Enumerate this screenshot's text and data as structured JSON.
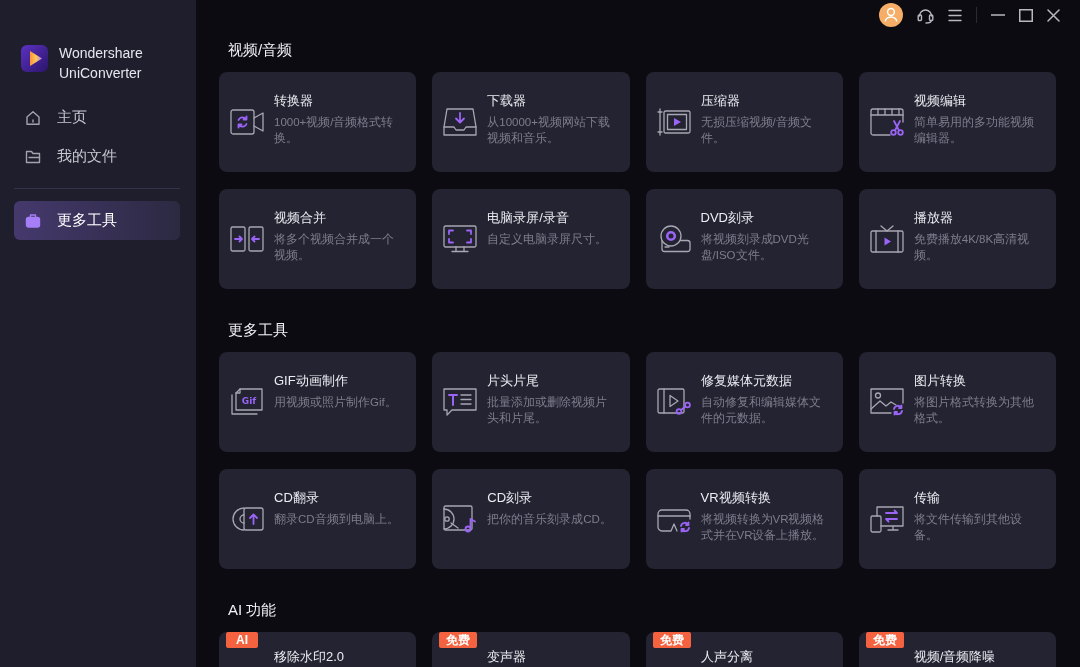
{
  "app": {
    "name": "Wondershare UniConverter"
  },
  "sidebar": {
    "groups": [
      {
        "items": [
          {
            "label": "主页",
            "selected": false
          },
          {
            "label": "我的文件",
            "selected": false
          }
        ]
      },
      {
        "items": [
          {
            "label": "更多工具",
            "selected": true
          }
        ]
      }
    ]
  },
  "sections": [
    {
      "title": "视频/音频",
      "cards": [
        {
          "title": "转换器",
          "description": "1000+视频/音频格式转换。"
        },
        {
          "title": "下载器",
          "description": "从10000+视频网站下载视频和音乐。"
        },
        {
          "title": "压缩器",
          "description": "无损压缩视频/音频文件。"
        },
        {
          "title": "视频编辑",
          "description": "简单易用的多功能视频编辑器。"
        },
        {
          "title": "视频合并",
          "description": "将多个视频合并成一个视频。"
        },
        {
          "title": "电脑录屏/录音",
          "description": "自定义电脑录屏尺寸。"
        },
        {
          "title": "DVD刻录",
          "description": "将视频刻录成DVD光盘/ISO文件。"
        },
        {
          "title": "播放器",
          "description": "免费播放4K/8K高清视频。"
        }
      ]
    },
    {
      "title": "更多工具",
      "cards": [
        {
          "title": "GIF动画制作",
          "description": "用视频或照片制作Gif。",
          "icon_text": "Gif"
        },
        {
          "title": "片头片尾",
          "description": "批量添加或删除视频片头和片尾。"
        },
        {
          "title": "修复媒体元数据",
          "description": "自动修复和编辑媒体文件的元数据。"
        },
        {
          "title": "图片转换",
          "description": "将图片格式转换为其他格式。"
        },
        {
          "title": "CD翻录",
          "description": "翻录CD音频到电脑上。"
        },
        {
          "title": "CD刻录",
          "description": "把你的音乐刻录成CD。"
        },
        {
          "title": "VR视频转换",
          "description": "将视频转换为VR视频格式并在VR设备上播放。"
        },
        {
          "title": "传输",
          "description": "将文件传输到其他设备。"
        }
      ]
    },
    {
      "title": "AI 功能",
      "cards": [
        {
          "badge": "AI",
          "title": "移除水印2.0"
        },
        {
          "badge": "免费",
          "title": "变声器"
        },
        {
          "badge": "免费",
          "title": "人声分离"
        },
        {
          "badge": "免费",
          "title": "视频/音频降噪"
        }
      ]
    }
  ]
}
